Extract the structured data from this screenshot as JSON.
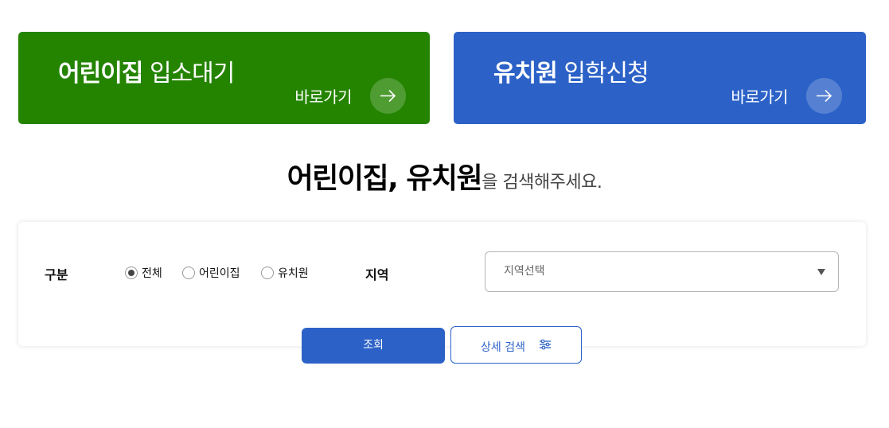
{
  "banners": {
    "daycare": {
      "title_bold": "어린이집",
      "title_light": "입소대기",
      "go_label": "바로가기",
      "color": "#248400",
      "icon": "arrow-right-icon"
    },
    "kindergarten": {
      "title_bold": "유치원",
      "title_light": "입학신청",
      "go_label": "바로가기",
      "color": "#2c62c7",
      "icon": "arrow-right-icon"
    }
  },
  "heading": {
    "bold": "어린이집, 유치원",
    "suffix": "을 검색해주세요."
  },
  "search": {
    "type_label": "구분",
    "type_options": [
      {
        "label": "전체",
        "selected": true
      },
      {
        "label": "어린이집",
        "selected": false
      },
      {
        "label": "유치원",
        "selected": false
      }
    ],
    "region_label": "지역",
    "region_select": "지역선택",
    "search_button": "조회",
    "detail_button": "상세 검색",
    "detail_icon": "sliders-icon"
  },
  "colors": {
    "green": "#248400",
    "blue": "#2c62c7"
  }
}
